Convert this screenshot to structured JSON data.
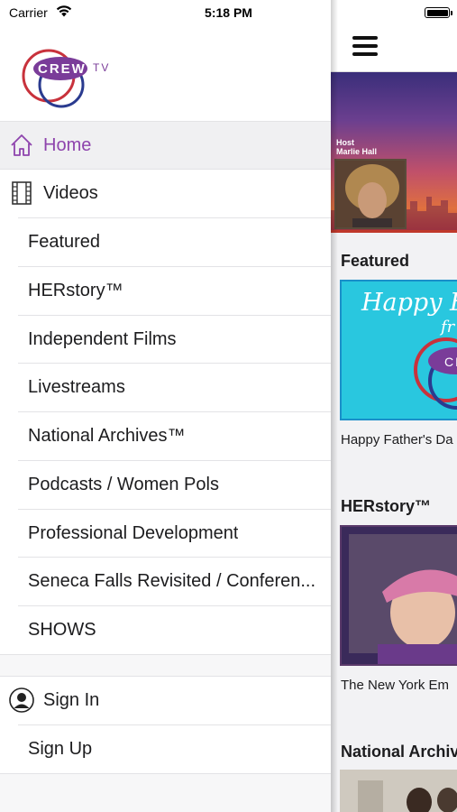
{
  "status_bar": {
    "carrier": "Carrier",
    "time": "5:18 PM",
    "battery_level": 1.0
  },
  "logo": {
    "text": "CREW",
    "suffix": "TV"
  },
  "menu": {
    "home": "Home",
    "videos": "Videos",
    "video_categories": [
      "Featured",
      "HERstory™",
      "Independent Films",
      "Livestreams",
      "National Archives™",
      "Podcasts / Women Pols",
      "Professional Development",
      "Seneca Falls Revisited / Conferen...",
      "SHOWS"
    ],
    "sign_in": "Sign In",
    "sign_up": "Sign Up",
    "active_item": "Home"
  },
  "content": {
    "hero": {
      "host_label": "Host",
      "host_name": "Marlie Hall"
    },
    "sections": [
      {
        "title": "Featured",
        "caption": "Happy Father's Da",
        "thumb_text": "Happy Fa",
        "thumb_text_2": "fr"
      },
      {
        "title": "HERstory™",
        "caption": "The New York Em"
      },
      {
        "title": "National Archiv"
      }
    ]
  },
  "colors": {
    "accent": "#8e44ad",
    "logo_purple": "#7a3c99",
    "logo_red": "#c8323c",
    "featured_thumb": "#29c7df"
  }
}
